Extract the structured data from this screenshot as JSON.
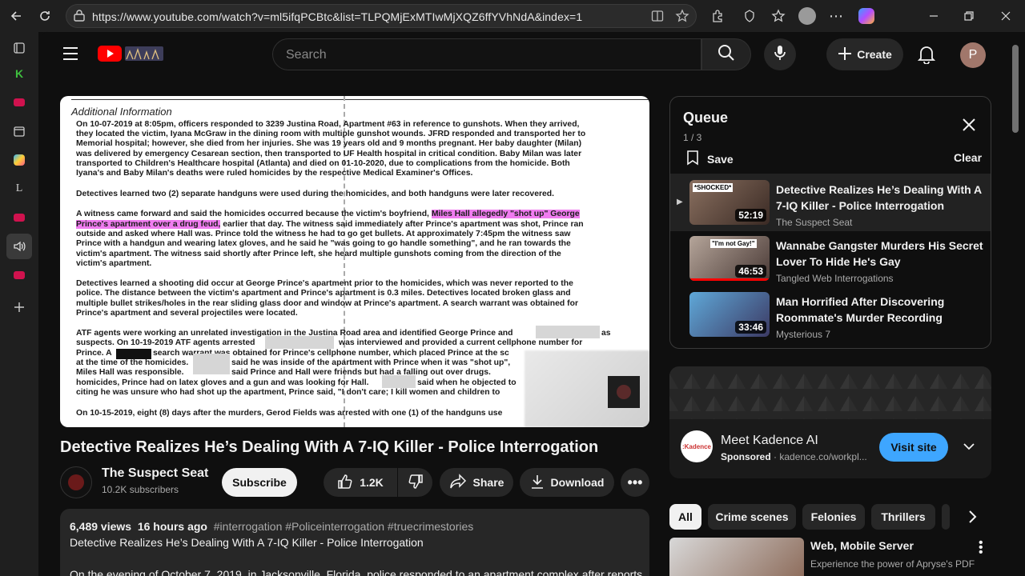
{
  "browser": {
    "url": "https://www.youtube.com/watch?v=ml5ifqPCBtc&list=TLPQMjExMTIwMjXQZ6ffYVhNdA&index=1"
  },
  "header": {
    "search_placeholder": "Search",
    "create_label": "Create",
    "avatar_letter": "P"
  },
  "document": {
    "heading": "Additional Information",
    "lines": [
      "On 10-07-2019 at 8:05pm, officers responded to 3239 Justina Road, Apartment #63 in reference to gunshots. When they arrived,",
      "they located the victim, Iyana McGraw in the dining room with multiple gunshot wounds. JFRD responded and transported her to",
      "Memorial hospital; however, she died from her injuries. She was 19 years old and 9 months pregnant. Her baby daughter (Milan)",
      "was delivered by emergency Cesarean section, then transported to UF Health hospital in critical condition. Baby Milan was later",
      "transported to Children's Healthcare hospital (Atlanta) and died on 01-10-2020, due to complications from the homicide. Both",
      "Iyana's and Baby Milan's deaths were ruled homicides by the respective Medical Examiner's Offices.",
      "Detectives learned two (2) separate handguns were used during the homicides, and both handguns were later recovered.",
      "A witness came forward and said the homicides occurred because the victim's boyfriend,",
      "Miles Hall allegedly \"shot up\" George",
      "Prince's apartment over a drug feud,",
      " earlier that day. The witness said immediately after Prince's apartment was shot, Prince ran",
      "outside and asked where Hall was. Prince told the witness he had to go get bullets. At approximately 7:45pm the witness saw",
      "Prince with a handgun and wearing latex gloves, and he said he \"was going to go handle something\", and he ran towards the",
      "victim's apartment. The witness said shortly after Prince left, she heard multiple gunshots coming from the direction of the",
      "victim's apartment.",
      "Detectives learned a shooting did occur at George Prince's apartment prior to the homicides, which was never reported to the",
      "police. The distance between the victim's apartment and Prince's apartment is 0.3 miles. Detectives located broken glass and",
      "multiple bullet strikes/holes in the rear sliding glass door and window at Prince's apartment. A search warrant was obtained for",
      "Prince's apartment and several projectiles were located.",
      "ATF agents were working an unrelated investigation in the Justina Road area and identified George Prince and",
      "as",
      "suspects. On 10-19-2019 ATF agents arrested",
      "was interviewed and provided a current cellphone number for",
      "Prince. A",
      "search warrant was obtained for Prince's cellphone number, which placed Prince at the sc",
      "at the time of the homicides.",
      "said he was inside of the apartment with Prince when it was \"shot up\",",
      "Miles Hall was responsible.",
      "said Prince and Hall were friends but had a falling out over drugs.",
      "homicides, Prince had on latex gloves and a gun and was looking for Hall.",
      "said when he objected to",
      "citing he was unsure who had shot up the apartment, Prince said, \"I don't care; I kill women and children to",
      "On 10-15-2019, eight (8) days after the murders, Gerod Fields was arrested with one (1) of the handguns use"
    ]
  },
  "video": {
    "title": "Detective Realizes He’s Dealing With A 7-IQ Killer - Police Interrogation",
    "channel_name": "The Suspect Seat",
    "subscribers": "10.2K subscribers",
    "subscribe_label": "Subscribe",
    "likes": "1.2K",
    "share_label": "Share",
    "download_label": "Download",
    "views": "6,489 views",
    "age": "16 hours ago",
    "hashtags": "#interrogation #Policeinterrogation #truecrimestories",
    "desc_title": "Detective Realizes He’s Dealing With A 7-IQ Killer - Police Interrogation",
    "desc_partial": "On the evening of October 7, 2019, in Jacksonville, Florida, police responded to an apartment complex after reports"
  },
  "queue": {
    "title": "Queue",
    "position": "1 / 3",
    "save_label": "Save",
    "clear_label": "Clear",
    "items": [
      {
        "title": "Detective Realizes He’s Dealing With A 7-IQ Killer - Police Interrogation",
        "channel": "The Suspect Seat",
        "duration": "52:19",
        "thumb_text": "*SHOCKED*"
      },
      {
        "title": "Wannabe Gangster Murders His Secret Lover To Hide He's Gay",
        "channel": "Tangled Web Interrogations",
        "duration": "46:53",
        "thumb_text": "\"I'm not Gay!\""
      },
      {
        "title": "Man Horrified After Discovering Roommate's Murder Recording",
        "channel": "Mysterious 7",
        "duration": "33:46",
        "thumb_text": ""
      }
    ]
  },
  "ad": {
    "title": "Meet Kadence AI",
    "sponsored": "Sponsored",
    "domain": "kadence.co/workpl...",
    "button": "Visit site",
    "logo_text": ":Kadence"
  },
  "chips": [
    "All",
    "Crime scenes",
    "Felonies",
    "Thrillers"
  ],
  "recommendation": {
    "title": "Web, Mobile Server",
    "subtitle": "Experience the power of Apryse's PDF"
  },
  "colors": {
    "background": "#0f0f0f",
    "youtube_red": "#ff0000",
    "highlight": "#f07cf0",
    "visit_button": "#3ea6ff"
  }
}
